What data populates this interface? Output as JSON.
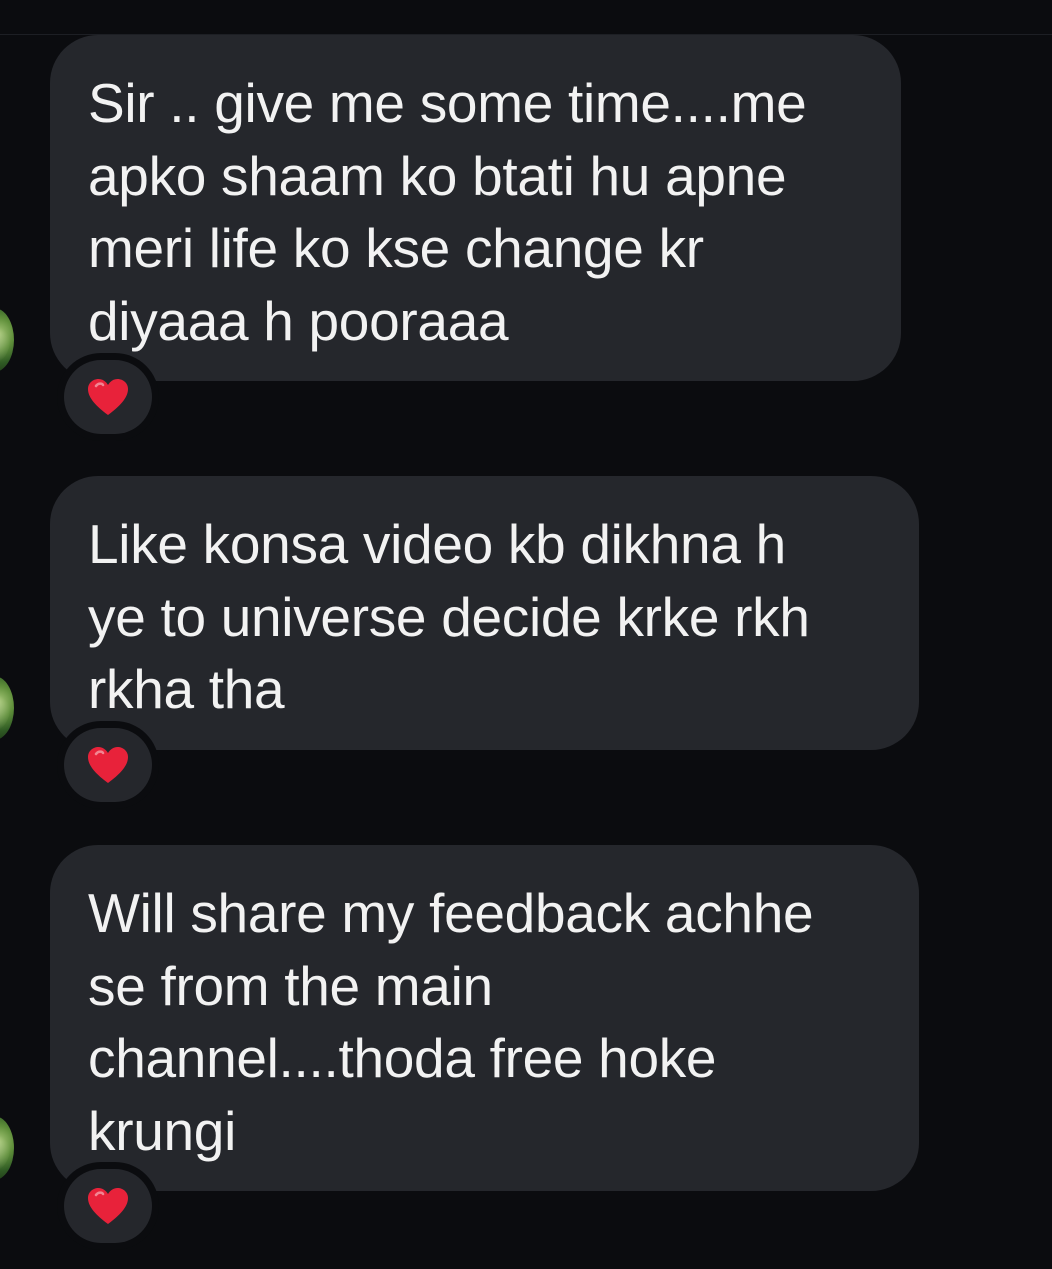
{
  "messages": [
    {
      "lines": [
        "Sir .. give me some time....me",
        "apko shaam ko btati hu apne",
        "meri life ko kse change kr",
        "diyaaa h pooraaa"
      ],
      "reaction": "heart-icon"
    },
    {
      "lines": [
        "Like konsa video kb dikhna h",
        "ye to universe decide krke rkh",
        "rkha tha"
      ],
      "reaction": "heart-icon"
    },
    {
      "lines": [
        "Will share my feedback achhe",
        "se from the main",
        "channel....thoda free hoke",
        "krungi"
      ],
      "reaction": "heart-icon"
    }
  ],
  "colors": {
    "background": "#0b0c0f",
    "bubble": "#25272c",
    "text": "#f2f2f2",
    "heart": "#e8223a"
  }
}
